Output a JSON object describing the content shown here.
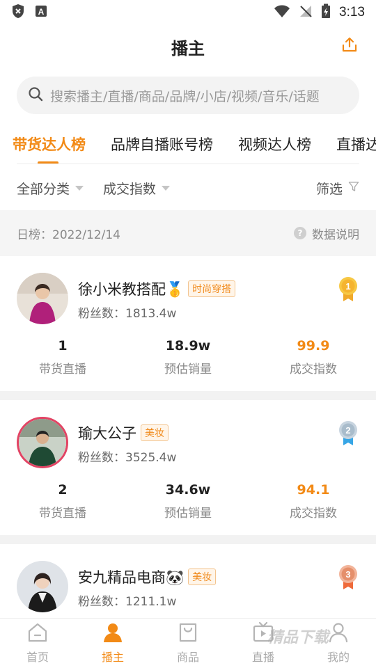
{
  "status_bar": {
    "time": "3:13",
    "app_icon_letter": "A"
  },
  "header": {
    "title": "播主",
    "share_icon": "share-upload-icon"
  },
  "search": {
    "placeholder": "搜索播主/直播/商品/品牌/小店/视频/音乐/话题"
  },
  "tabs": [
    {
      "label": "带货达人榜",
      "active": true
    },
    {
      "label": "品牌自播账号榜",
      "active": false
    },
    {
      "label": "视频达人榜",
      "active": false
    },
    {
      "label": "直播达",
      "active": false
    }
  ],
  "filters": {
    "category": "全部分类",
    "metric": "成交指数",
    "filter": "筛选"
  },
  "date_bar": {
    "label": "日榜：2022/12/14",
    "help": "数据说明"
  },
  "stat_labels": {
    "live": "带货直播",
    "sales": "预估销量",
    "index": "成交指数"
  },
  "hosts": [
    {
      "name": "徐小米教搭配🥇",
      "tag": "时尚穿搭",
      "fans": "粉丝数：1813.4w",
      "rank": "1",
      "live": "1",
      "sales": "18.9w",
      "index": "99.9"
    },
    {
      "name": "瑜大公子",
      "tag": "美妆",
      "fans": "粉丝数：3525.4w",
      "rank": "2",
      "live": "2",
      "sales": "34.6w",
      "index": "94.1"
    },
    {
      "name": "安九精品电商🐼",
      "tag": "美妆",
      "fans": "粉丝数：1211.1w",
      "rank": "3"
    }
  ],
  "bottom_nav": [
    {
      "label": "首页",
      "icon": "home-icon",
      "active": false
    },
    {
      "label": "播主",
      "icon": "person-icon",
      "active": true
    },
    {
      "label": "商品",
      "icon": "bag-icon",
      "active": false
    },
    {
      "label": "直播",
      "icon": "tv-icon",
      "active": false
    },
    {
      "label": "我的",
      "icon": "user-icon",
      "active": false
    }
  ],
  "watermark": "精品下载",
  "colors": {
    "accent": "#f28a16",
    "gold": "#f5b73a",
    "silver": "#9fb4c8",
    "bronze": "#e5956d"
  }
}
